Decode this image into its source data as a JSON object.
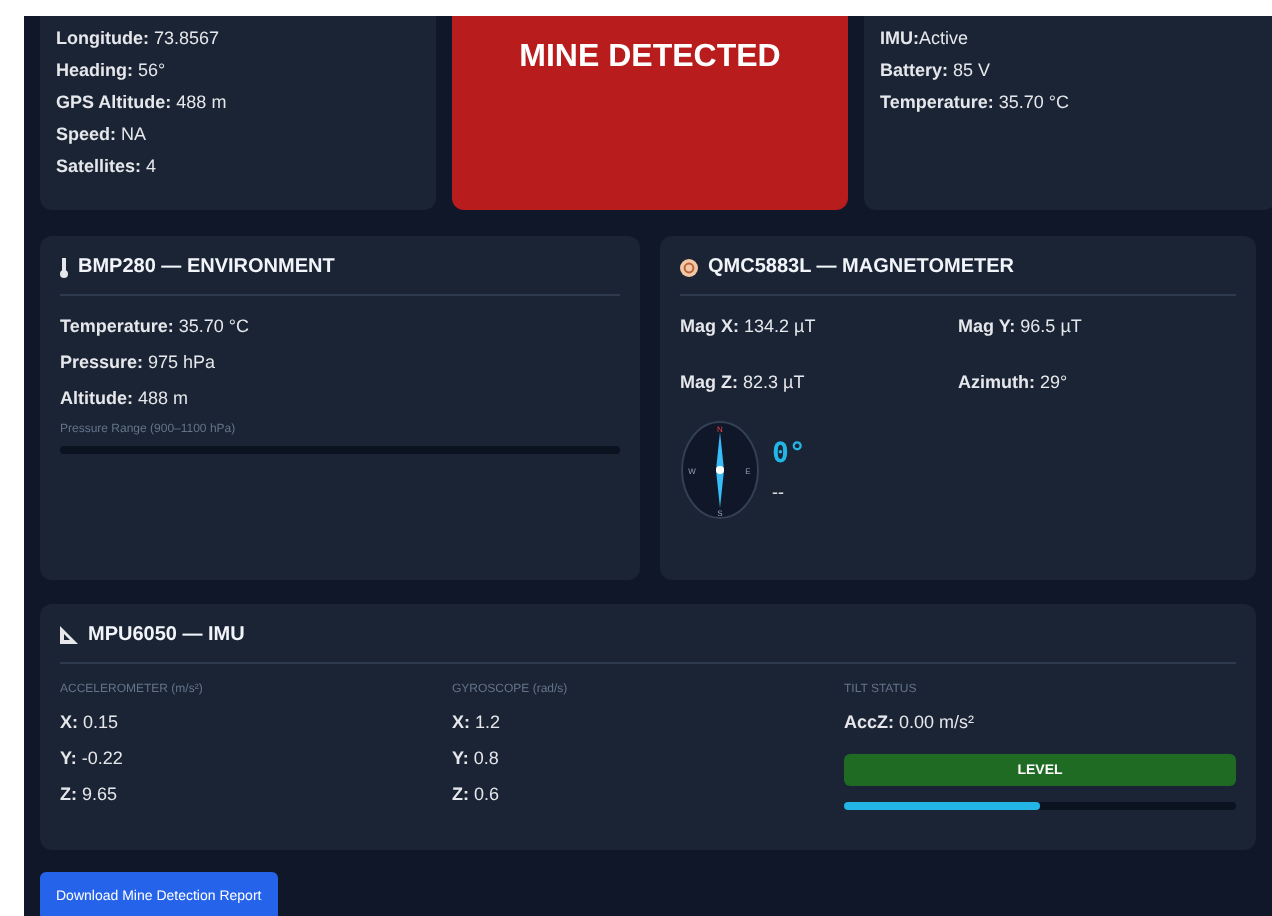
{
  "gps": {
    "lines": [
      "**Longitude:** 73.8567",
      "**Heading:** 56°",
      "**GPS Altitude:** 488 m",
      "**Speed:** NA",
      "**Satellites:** 4"
    ]
  },
  "alert": {
    "title": "MINE DETECTED"
  },
  "status": {
    "lines": [
      "**IMU:**Active",
      "**Battery:** 85 V",
      "**Temperature:** 35.70 °C"
    ]
  },
  "environment": {
    "title": "BMP280 — ENVIRONMENT",
    "lines": [
      "**Temperature:** 35.70 °C",
      "**Pressure:** 975 hPa",
      "**Altitude:** 488 m"
    ],
    "range_label": "Pressure Range (900–1100 hPa)"
  },
  "magnetometer": {
    "title": "QMC5883L — MAGNETOMETER",
    "readings": [
      "**Mag X:** 134.2 µT",
      "**Mag Y:** 96.5 µT",
      "**Mag Z:** 82.3 µT",
      "**Azimuth:** 29°"
    ],
    "compass": {
      "n": "N",
      "e": "E",
      "s": "S",
      "w": "W",
      "heading": "0°",
      "direction": "--"
    }
  },
  "imu": {
    "title": "MPU6050 — IMU",
    "columns": [
      {
        "heading": "ACCELEROMETER (m/s²)",
        "lines": [
          "**X:** 0.15",
          "**Y:** -0.22",
          "**Z:** 9.65"
        ]
      },
      {
        "heading": "GYROSCOPE (rad/s)",
        "lines": [
          "**X:** 1.2",
          "**Y:** 0.8",
          "**Z:** 0.6"
        ]
      }
    ],
    "tilt": {
      "heading": "TILT STATUS",
      "reading": "**AccZ:** 0.00 m/s²",
      "status": "LEVEL",
      "level": 0.5
    }
  },
  "buttons": [
    "Download Mine Detection Report"
  ]
}
